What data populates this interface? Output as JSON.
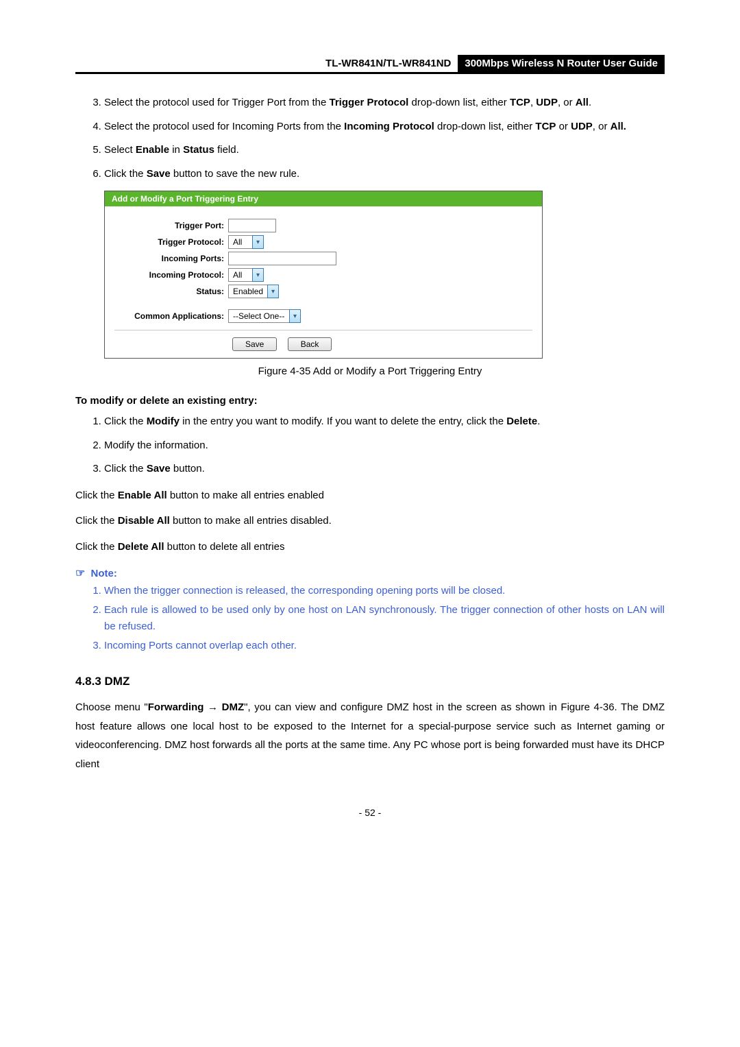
{
  "header": {
    "left": "TL-WR841N/TL-WR841ND",
    "right": "300Mbps Wireless N Router User Guide"
  },
  "olA": {
    "start": 3,
    "items": [
      {
        "pre": "Select the protocol used for Trigger Port from the ",
        "b1": "Trigger Protocol",
        "mid1": " drop-down list, either ",
        "b2": "TCP",
        "mid2": ", ",
        "b3": "UDP",
        "mid3": ", or ",
        "b4": "All",
        "post": "."
      },
      {
        "pre": "Select the protocol used for Incoming Ports from the ",
        "b1": "Incoming Protocol",
        "mid1": " drop-down list, either ",
        "b2": "TCP",
        "mid2": " or ",
        "b3": "UDP",
        "mid3": ", or ",
        "b4": "All.",
        "post": ""
      },
      {
        "pre": "Select ",
        "b1": "Enable",
        "mid1": " in ",
        "b2": "Status",
        "post": " field."
      },
      {
        "pre": "Click the ",
        "b1": "Save",
        "post": " button to save the new rule."
      }
    ]
  },
  "figure": {
    "title": "Add or Modify a Port Triggering Entry",
    "labels": {
      "triggerPort": "Trigger Port:",
      "triggerProtocol": "Trigger Protocol:",
      "incomingPorts": "Incoming Ports:",
      "incomingProtocol": "Incoming Protocol:",
      "status": "Status:",
      "commonApps": "Common Applications:"
    },
    "values": {
      "triggerProtocol": "All",
      "incomingProtocol": "All",
      "status": "Enabled",
      "commonApps": "--Select One--"
    },
    "buttons": {
      "save": "Save",
      "back": "Back"
    },
    "caption": "Figure 4-35    Add or Modify a Port Triggering Entry"
  },
  "modifyHeading": "To modify or delete an existing entry:",
  "olB": {
    "items": [
      {
        "pre": "Click the ",
        "b1": "Modify",
        "mid1": " in the entry you want to modify. If you want to delete the entry, click the ",
        "b2": "Delete",
        "post": "."
      },
      {
        "pre": "Modify the information."
      },
      {
        "pre": "Click the ",
        "b1": "Save",
        "post": " button."
      }
    ]
  },
  "paras": {
    "enableAll": {
      "pre": "Click the ",
      "b": "Enable All",
      "post": " button to make all entries enabled"
    },
    "disableAll": {
      "pre": "Click the ",
      "b": "Disable All",
      "post": " button to make all entries disabled."
    },
    "deleteAll": {
      "pre": "Click the ",
      "b": "Delete All",
      "post": " button to delete all entries"
    }
  },
  "note": {
    "label": "Note:",
    "items": [
      "When the trigger connection is released, the corresponding opening ports will be closed.",
      "Each rule is allowed to be used only by one host on LAN synchronously. The trigger connection of other hosts on LAN will be refused.",
      "Incoming Ports cannot overlap each other."
    ]
  },
  "section": {
    "heading": "4.8.3  DMZ"
  },
  "dmzPara": {
    "pre": "Choose menu \"",
    "b1": "Forwarding",
    "arrow": " → ",
    "b2": "DMZ",
    "post": "\", you can view and configure DMZ host in the screen as shown in Figure 4-36. The DMZ host feature allows one local host to be exposed to the Internet for a special-purpose service such as Internet gaming or videoconferencing. DMZ host forwards all the ports at the same time. Any PC whose port is being forwarded must have its DHCP client"
  },
  "pageNumber": "- 52 -"
}
